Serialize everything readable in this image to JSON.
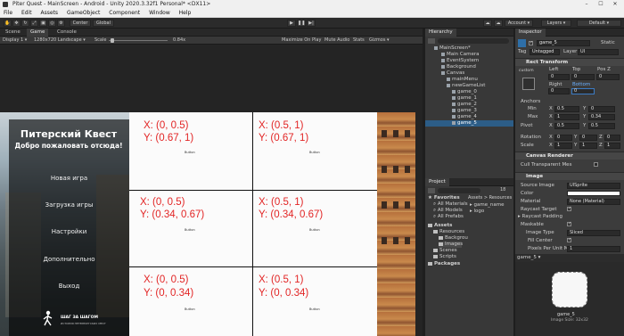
{
  "window": {
    "title": "Piter Quest - MainScreen - Android - Unity 2020.3.32f1 Personal* <DX11>",
    "controls": [
      "–",
      "☐",
      "✕"
    ]
  },
  "menu": [
    "File",
    "Edit",
    "Assets",
    "GameObject",
    "Component",
    "Window",
    "Help"
  ],
  "toolbar": {
    "center_label": "Center",
    "global_label": "Global",
    "account_label": "Account ▾",
    "layers_label": "Layers ▾",
    "layout_label": "Default ▾"
  },
  "scene_tabs": [
    "Scene",
    "Game",
    "Console"
  ],
  "game_bar": {
    "display": "Display 1 ▾",
    "resolution": "1280x720 Landscape ▾",
    "scale_label": "Scale",
    "scale_value": "0.84x",
    "maximize": "Maximize On Play",
    "mute": "Mute Audio",
    "stats": "Stats",
    "gizmos": "Gizmos ▾"
  },
  "game_menu": {
    "title": "Питерский Квест",
    "subtitle": "Добро пожаловать отсюда!",
    "items": [
      "Новая игра",
      "Загрузка игры",
      "Настройки",
      "Дополнительно",
      "Выход"
    ],
    "logo_text": "ШАГ ЗА ШАГОМ",
    "logo_sub": "ИСТОРИЯ ПЕТЕРБУРГСКИХ МЕСТ"
  },
  "grid_cells": [
    {
      "x_line": "X: (0, 0.5)",
      "y_line": "Y: (0.67, 1)",
      "button": "Button"
    },
    {
      "x_line": "X: (0.5, 1)",
      "y_line": "Y: (0.67, 1)",
      "button": "Button"
    },
    {
      "x_line": "X: (0, 0.5)",
      "y_line": "Y: (0.34, 0.67)",
      "button": "Button"
    },
    {
      "x_line": "X: (0.5, 1)",
      "y_line": "Y: (0.34, 0.67)",
      "button": "Button"
    },
    {
      "x_line": "X: (0, 0.5)",
      "y_line": "Y: (0, 0.34)",
      "button": "Button"
    },
    {
      "x_line": "X: (0.5, 1)",
      "y_line": "Y: (0, 0.34)",
      "button": "Button"
    }
  ],
  "hierarchy": {
    "tab": "Hierarchy",
    "rows": [
      "MainScreen*",
      "Main Camera",
      "EventSystem",
      "Background",
      "Canvas",
      "mainMenu",
      "newGameList",
      "game_0",
      "game_1",
      "game_2",
      "game_3",
      "game_4",
      "game_5"
    ]
  },
  "project": {
    "tab": "Project",
    "tree": [
      "Favorites",
      "All Materials",
      "All Models",
      "All Prefabs",
      "Assets",
      "Resources",
      "Backgrou",
      "Images",
      "Scenes",
      "Scripts",
      "Packages"
    ],
    "breadcrumb": "Assets > Resources",
    "files": [
      "game_name",
      "logo"
    ],
    "badge": "18"
  },
  "inspector": {
    "tab": "Inspector",
    "object_name": "game_5",
    "static_label": "Static",
    "tag_label": "Tag",
    "tag_value": "Untagged",
    "layer_label": "Layer",
    "layer_value": "UI",
    "rect_transform": "Rect Transform",
    "anchor_preset": "custom",
    "col_headers": [
      "Left",
      "Top",
      "Pos Z"
    ],
    "left": "0",
    "top": "0",
    "pos_z": "0",
    "col_headers2": [
      "Right",
      "Bottom"
    ],
    "right": "0",
    "bottom": "0",
    "anchors_label": "Anchors",
    "min_label": "Min",
    "min_x": "0.5",
    "min_y": "0",
    "max_label": "Max",
    "max_x": "1",
    "max_y": "0.34",
    "pivot_label": "Pivot",
    "pivot_x": "0.5",
    "pivot_y": "0.5",
    "rotation_label": "Rotation",
    "rot_x": "0",
    "rot_y": "0",
    "rot_z": "0",
    "scale_label": "Scale",
    "scale_x": "1",
    "scale_y": "1",
    "scale_z": "1",
    "canvas_renderer": "Canvas Renderer",
    "cull_label": "Cull Transparent Mes",
    "image_header": "Image",
    "source_label": "Source Image",
    "source_value": "UISprite",
    "color_label": "Color",
    "material_label": "Material",
    "material_value": "None (Material)",
    "raycast_target": "Raycast Target",
    "raycast_padding": "Raycast Padding",
    "maskable": "Maskable",
    "image_type_label": "Image Type",
    "image_type_value": "Sliced",
    "fill_center": "Fill Center",
    "ppu_label": "Pixels Per Unit Mul",
    "ppu_value": "1"
  },
  "preview": {
    "title": "game_5 ▾",
    "sprite_label": "game_5",
    "sprite_info": "Image Size: 32x32"
  }
}
